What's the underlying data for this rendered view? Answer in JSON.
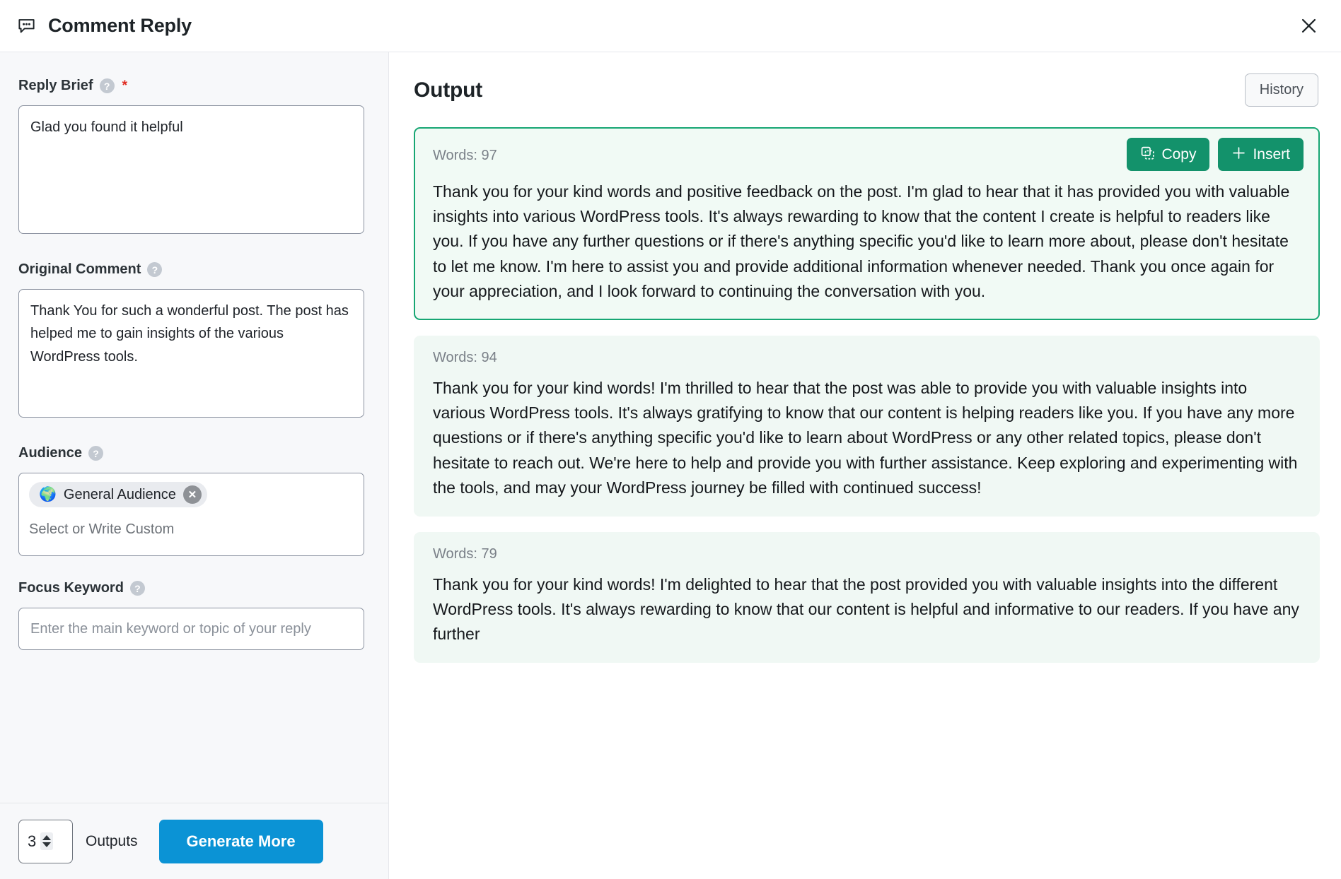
{
  "header": {
    "icon": "comment-bubble-icon",
    "title": "Comment Reply",
    "close_label": "✕"
  },
  "left_panel": {
    "fields": [
      {
        "label": "Reply Brief",
        "help": "?",
        "required": true,
        "value": "Glad you found it helpful"
      },
      {
        "label": "Original Comment",
        "help": "?",
        "required": false,
        "value": "Thank You for such a wonderful post. The post has helped me to gain insights of the various WordPress tools."
      },
      {
        "label": "Audience",
        "help": "?",
        "required": false,
        "chip": {
          "emoji": "🌍",
          "label": "General Audience",
          "remove": "✕"
        },
        "placeholder": "Select or Write Custom"
      },
      {
        "label": "Focus Keyword",
        "help": "?",
        "required": false,
        "placeholder": "Enter the main keyword or topic of your reply"
      }
    ],
    "footer": {
      "outputs_value": "3",
      "outputs_label": "Outputs",
      "generate_label": "Generate More"
    }
  },
  "right_panel": {
    "title": "Output",
    "history_label": "History",
    "copy_label": "Copy",
    "insert_label": "Insert",
    "results": [
      {
        "words_label": "Words: 97",
        "text": "Thank you for your kind words and positive feedback on the post. I'm glad to hear that it has provided you with valuable insights into various WordPress tools. It's always rewarding to know that the content I create is helpful to readers like you. If you have any further questions or if there's anything specific you'd like to learn more about, please don't hesitate to let me know. I'm here to assist you and provide additional information whenever needed. Thank you once again for your appreciation, and I look forward to continuing the conversation with you.",
        "active": true
      },
      {
        "words_label": "Words: 94",
        "text": "Thank you for your kind words! I'm thrilled to hear that the post was able to provide you with valuable insights into various WordPress tools. It's always gratifying to know that our content is helping readers like you. If you have any more questions or if there's anything specific you'd like to learn about WordPress or any other related topics, please don't hesitate to reach out. We're here to help and provide you with further assistance. Keep exploring and experimenting with the tools, and may your WordPress journey be filled with continued success!",
        "active": false
      },
      {
        "words_label": "Words: 79",
        "text": "Thank you for your kind words! I'm delighted to hear that the post provided you with valuable insights into the different WordPress tools. It's always rewarding to know that our content is helpful and informative to our readers. If you have any further",
        "active": false
      }
    ]
  },
  "annotation": {
    "arrow_color": "#7b3fe4",
    "points_to": "copy-button"
  },
  "colors": {
    "accent_green": "#13926b",
    "accent_blue": "#0b93d5",
    "card_bg": "#f0f8f4",
    "active_border": "#17a673",
    "required_red": "#e02b20"
  }
}
